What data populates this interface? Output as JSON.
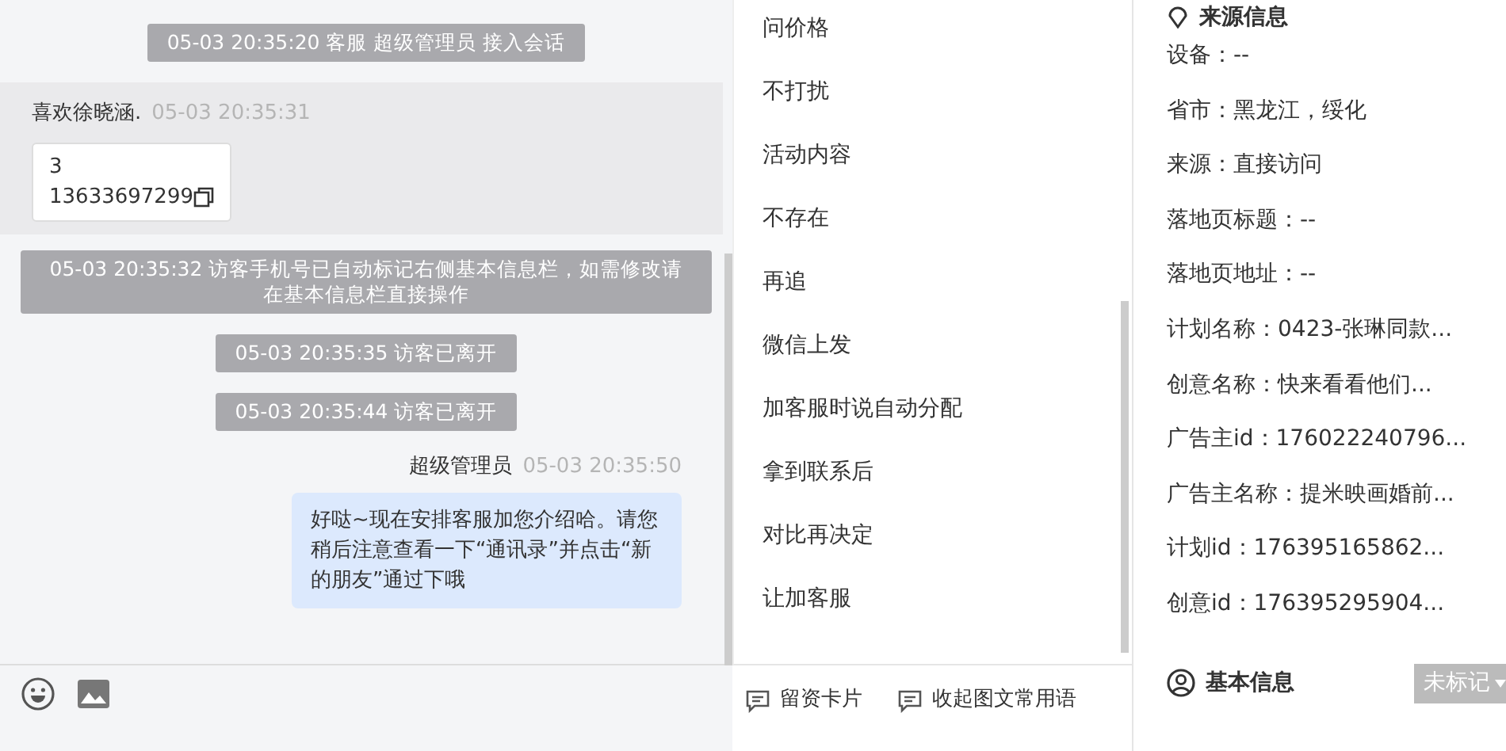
{
  "chat": {
    "messages": [
      {
        "kind": "system",
        "text": "05-03 20:35:20 客服 超级管理员 接入会话"
      },
      {
        "kind": "visitor",
        "sender": "喜欢徐晓涵.",
        "time": "05-03 20:35:31",
        "lines": [
          "3",
          "13633697299"
        ]
      },
      {
        "kind": "system",
        "text": "05-03 20:35:32 访客手机号已自动标记右侧基本信息栏，如需修改请在基本信息栏直接操作"
      },
      {
        "kind": "system",
        "text": "05-03 20:35:35 访客已离开"
      },
      {
        "kind": "system",
        "text": "05-03 20:35:44 访客已离开"
      },
      {
        "kind": "agent",
        "sender": "超级管理员",
        "time": "05-03 20:35:50",
        "text": "好哒~现在安排客服加您介绍哈。请您稍后注意查看一下“通讯录”并点击“新的朋友”通过下哦"
      }
    ]
  },
  "quick_replies": [
    "问价格",
    "不打扰",
    "活动内容",
    "不存在",
    "再追",
    "微信上发",
    "加客服时说自动分配",
    "拿到联系后",
    "对比再决定",
    "让加客服"
  ],
  "quick_actions": [
    "留资卡片",
    "收起图文常用语"
  ],
  "source_info": {
    "title": "来源信息",
    "fields": [
      "设备：--",
      "省市：黑龙江，绥化",
      "来源：直接访问",
      "落地页标题：--",
      "落地页地址：--",
      "计划名称：0423-张琳同款...",
      "创意名称：快来看看他们...",
      "广告主id：176022240796...",
      "广告主名称：提米映画婚前...",
      "计划id：176395165862...",
      "创意id：176395295904..."
    ]
  },
  "basic_info": {
    "title": "基本信息",
    "tag": "未标记"
  }
}
